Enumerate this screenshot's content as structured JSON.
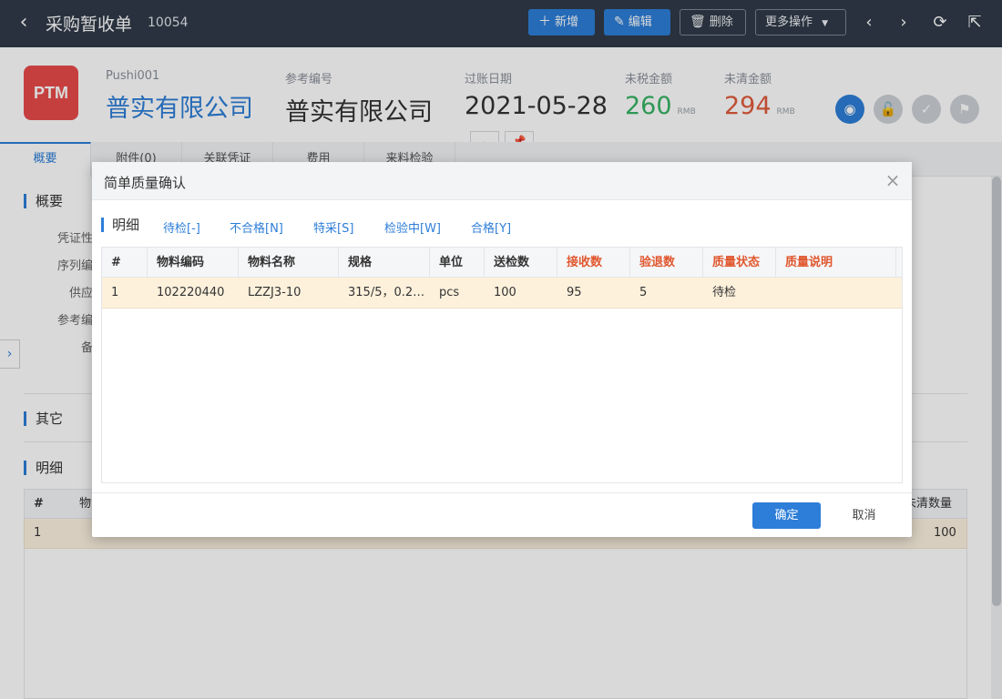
{
  "topbar": {
    "title": "采购暂收单",
    "doc_number": "10054",
    "new_label": "新增",
    "edit_label": "编辑",
    "delete_label": "删除",
    "more_label": "更多操作"
  },
  "header": {
    "logo_text": "PTM",
    "fields": [
      {
        "label": "Pushi001",
        "value": "普实有限公司"
      },
      {
        "label": "参考编号",
        "value": "普实有限公司"
      },
      {
        "label": "过账日期",
        "value": "2021-05-28"
      },
      {
        "label": "未税金额",
        "value": "260",
        "unit": "RMB"
      },
      {
        "label": "未清金额",
        "value": "294",
        "unit": "RMB"
      }
    ]
  },
  "tabs": [
    "概要",
    "附件(0)",
    "关联凭证",
    "费用",
    "来料检验"
  ],
  "body": {
    "overview_title": "概要",
    "field_labels": [
      "凭证性",
      "序列编",
      "供应",
      "参考编",
      "备"
    ],
    "other_title": "其它",
    "detail_title": "明细",
    "detail_header_first": "#",
    "detail_header_second": "物",
    "detail_header_last": "未清数量",
    "detail_row": {
      "index": "1",
      "open_qty": "100"
    }
  },
  "modal": {
    "title": "简单质量确认",
    "section_title": "明细",
    "filters": [
      "待检[-]",
      "不合格[N]",
      "特采[S]",
      "检验中[W]",
      "合格[Y]"
    ],
    "columns": [
      "#",
      "物料编码",
      "物料名称",
      "规格",
      "单位",
      "送检数",
      "接收数",
      "验退数",
      "质量状态",
      "质量说明"
    ],
    "rows": [
      {
        "index": "1",
        "code": "102220440",
        "name": "LZZJ3-10",
        "spec": "315/5，0.2…",
        "unit": "pcs",
        "inspect_qty": "100",
        "accept_qty": "95",
        "reject_qty": "5",
        "status": "待检",
        "note": ""
      }
    ],
    "ok_label": "确定",
    "cancel_label": "取消"
  },
  "colors": {
    "accent": "#2d7ed8",
    "topbar": "#2f3a48",
    "logo": "#e94b4b",
    "amount_untaxed": "#35b363",
    "amount_open": "#e05b3b",
    "highlight_header": "#e0572e",
    "selected_row": "#fdf1dc"
  }
}
